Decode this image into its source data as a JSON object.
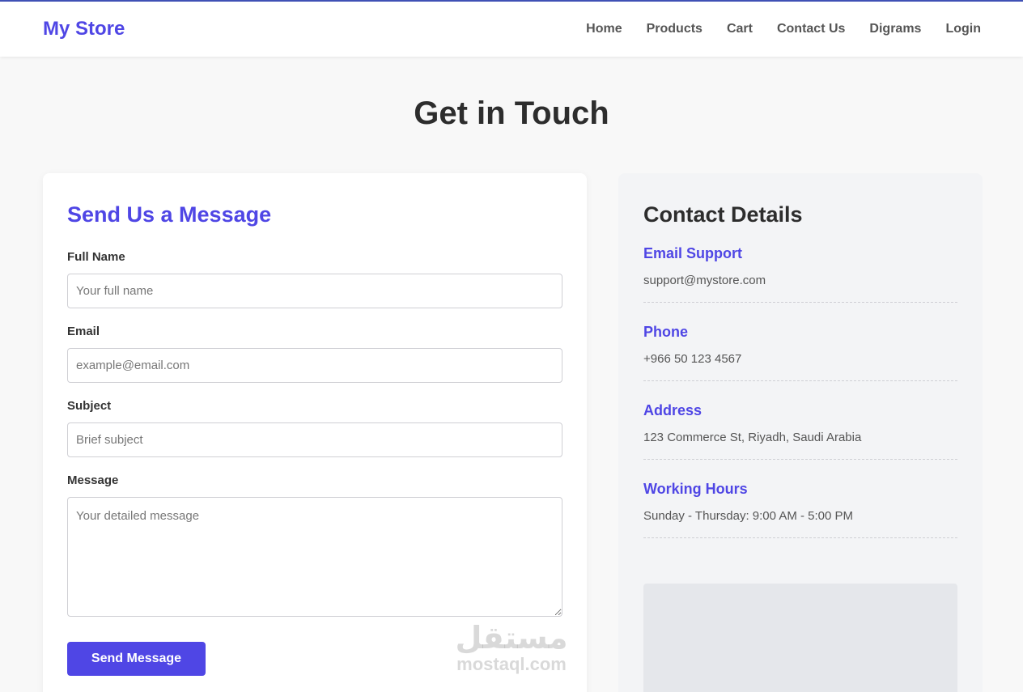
{
  "header": {
    "brand": "My Store",
    "nav": [
      "Home",
      "Products",
      "Cart",
      "Contact Us",
      "Digrams",
      "Login"
    ]
  },
  "page": {
    "title": "Get in Touch"
  },
  "form": {
    "title": "Send Us a Message",
    "fields": [
      {
        "label": "Full Name",
        "placeholder": "Your full name"
      },
      {
        "label": "Email",
        "placeholder": "example@email.com"
      },
      {
        "label": "Subject",
        "placeholder": "Brief subject"
      },
      {
        "label": "Message",
        "placeholder": "Your detailed message"
      }
    ],
    "submit_label": "Send Message"
  },
  "details": {
    "title": "Contact Details",
    "items": [
      {
        "heading": "Email Support",
        "value": "support@mystore.com"
      },
      {
        "heading": "Phone",
        "value": "+966 50 123 4567"
      },
      {
        "heading": "Address",
        "value": "123 Commerce St, Riyadh, Saudi Arabia"
      },
      {
        "heading": "Working Hours",
        "value": "Sunday - Thursday: 9:00 AM - 5:00 PM"
      }
    ]
  },
  "watermark": {
    "arabic": "مستقل",
    "latin": "mostaql.com"
  },
  "colors": {
    "accent": "#4f46e5",
    "topline": "#3f51b5",
    "background": "#f8f8f8"
  }
}
